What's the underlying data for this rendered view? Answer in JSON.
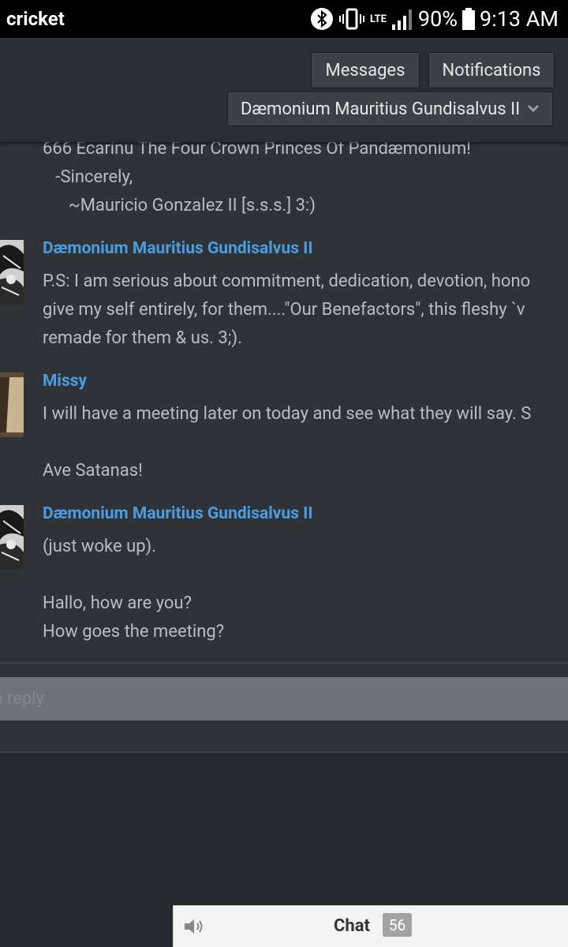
{
  "status_bar": {
    "carrier": "cricket",
    "network": "LTE",
    "battery": "90%",
    "time": "9:13 AM"
  },
  "header": {
    "messages_label": "Messages",
    "notifications_label": "Notifications",
    "user_menu_label": "Dæmonium Mauritius Gundisalvus II"
  },
  "messages": [
    {
      "author": "",
      "lines": [
        "666 Ecarinu The Four Crown Princes Of Pandæmonium!",
        "   -Sincerely,",
        "      ~Mauricio Gonzalez II [s.s.s.] 3:)"
      ]
    },
    {
      "author": "Dæmonium Mauritius Gundisalvus II",
      "lines": [
        "P.S: I am serious about commitment, dedication, devotion, hono",
        "give my self entirely, for them....\"Our Benefactors\", this fleshy `v",
        "remade for them & us. 3;)."
      ]
    },
    {
      "author": "Missy",
      "lines": [
        "I will have a meeting later on today and see what they will say. S",
        "",
        "Ave Satanas!"
      ]
    },
    {
      "author": "Dæmonium Mauritius Gundisalvus II",
      "lines": [
        "(just woke up).",
        "",
        "Hallo, how are you?",
        "How goes the meeting?"
      ]
    }
  ],
  "reply": {
    "placeholder": "e reply"
  },
  "chat": {
    "label": "Chat",
    "count": "56"
  }
}
